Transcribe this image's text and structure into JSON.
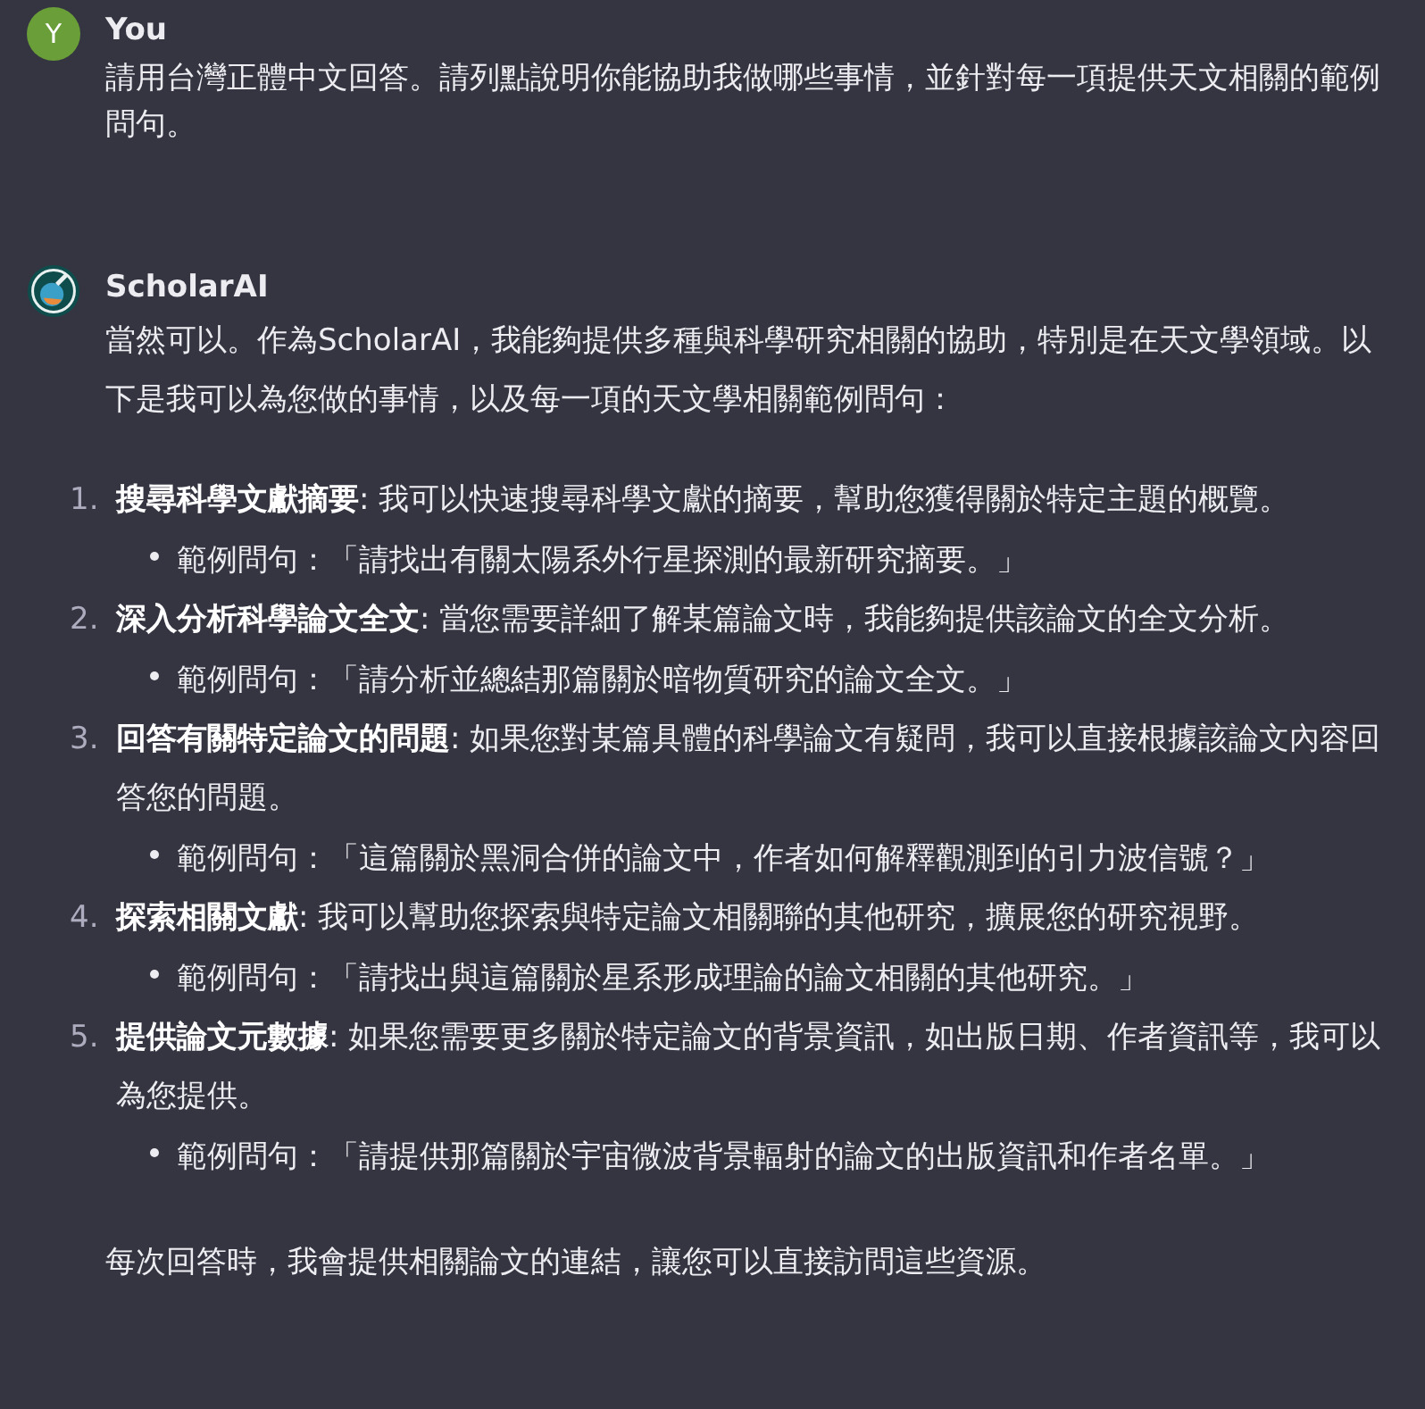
{
  "messages": [
    {
      "author": "You",
      "avatar_letter": "Y",
      "kind": "user",
      "paragraphs": [
        "請用台灣正體中文回答。請列點說明你能協助我做哪些事情，並針對每一項提供天文相關的範例問句。"
      ]
    },
    {
      "author": "ScholarAI",
      "kind": "assistant",
      "intro": "當然可以。作為ScholarAI，我能夠提供多種與科學研究相關的協助，特別是在天文學領域。以下是我可以為您做的事情，以及每一項的天文學相關範例問句：",
      "items": [
        {
          "number": "1.",
          "text": "**搜尋科學文獻摘要**: 我可以快速搜尋科學文獻的摘要，幫助您獲得關於特定主題的概覽。",
          "example": "範例問句：「請找出有關太陽系外行星探測的最新研究摘要。」"
        },
        {
          "number": "2.",
          "text": "**深入分析科學論文全文**: 當您需要詳細了解某篇論文時，我能夠提供該論文的全文分析。",
          "example": "範例問句：「請分析並總結那篇關於暗物質研究的論文全文。」"
        },
        {
          "number": "3.",
          "text": "**回答有關特定論文的問題**: 如果您對某篇具體的科學論文有疑問，我可以直接根據該論文內容回答您的問題。",
          "example": "範例問句：「這篇關於黑洞合併的論文中，作者如何解釋觀測到的引力波信號？」"
        },
        {
          "number": "4.",
          "text": "**探索相關文獻**: 我可以幫助您探索與特定論文相關聯的其他研究，擴展您的研究視野。",
          "example": "範例問句：「請找出與這篇關於星系形成理論的論文相關的其他研究。」"
        },
        {
          "number": "5.",
          "text": "**提供論文元數據**: 如果您需要更多關於特定論文的背景資訊，如出版日期、作者資訊等，我可以為您提供。",
          "example": "範例問句：「請提供那篇關於宇宙微波背景輻射的論文的出版資訊和作者名單。」"
        }
      ],
      "outro": "每次回答時，我會提供相關論文的連結，讓您可以直接訪問這些資源。"
    }
  ]
}
